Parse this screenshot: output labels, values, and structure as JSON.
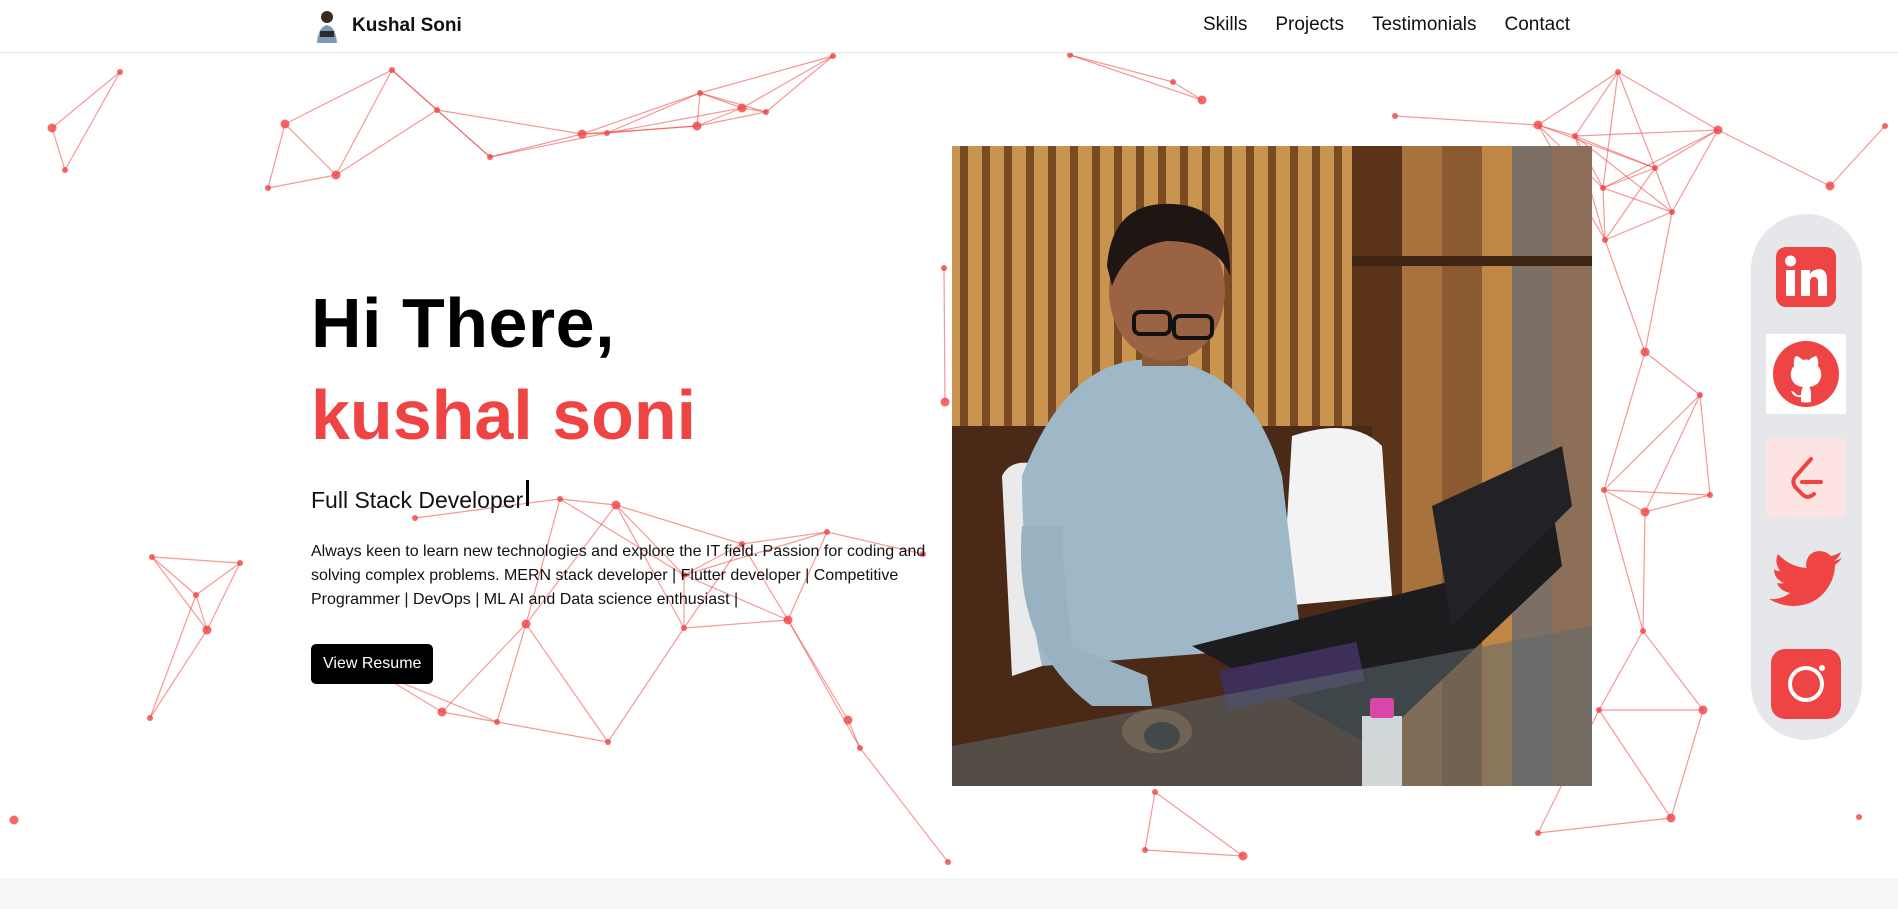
{
  "header": {
    "brand_name": "Kushal Soni",
    "nav": [
      "Skills",
      "Projects",
      "Testimonials",
      "Contact"
    ]
  },
  "hero": {
    "greeting": "Hi There,",
    "name": "kushal soni",
    "role": "Full Stack Developer",
    "bio": "Always keen to learn new technologies and explore the IT field. Passion for coding and solving complex problems. MERN stack developer | Flutter developer | Competitive Programmer | DevOps | ML AI and Data science enthusiast |",
    "resume_button": "View Resume"
  },
  "social": [
    "linkedin-icon",
    "github-icon",
    "leetcode-icon",
    "twitter-icon",
    "instagram-icon"
  ],
  "colors": {
    "accent": "#ef4444",
    "button_bg": "#000000",
    "social_bar_bg": "#e5e7eb"
  }
}
